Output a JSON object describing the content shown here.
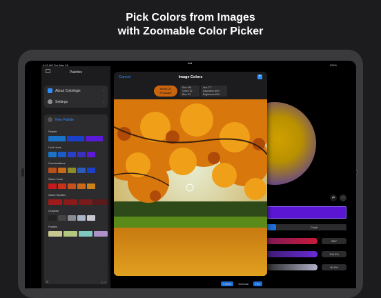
{
  "headline": {
    "line1": "Pick Colors from Images",
    "line2": "with Zoomable Color Picker"
  },
  "status": {
    "time": "9:41 AM  Tue May 18",
    "battery": "100%"
  },
  "sidebar": {
    "title": "Palettes",
    "items": [
      {
        "label": "About Colorlogix"
      },
      {
        "label": "Settings"
      }
    ],
    "new_palette": "New Palette",
    "palettes": [
      {
        "label": "Palette",
        "colors": [
          "#1a73c8",
          "#1a3fc8",
          "#5a1ad8"
        ],
        "wide": true
      },
      {
        "label": "Cool Hues",
        "colors": [
          "#1a73c8",
          "#1a5bc8",
          "#2a3fc8",
          "#3b2fc0",
          "#5a1ad8"
        ]
      },
      {
        "label": "Combinations",
        "colors": [
          "#b8501a",
          "#c86a1a",
          "#8c8c2a",
          "#2a5bb8",
          "#1a3fc8"
        ]
      },
      {
        "label": "Warm Hues",
        "colors": [
          "#c81a1a",
          "#c8301a",
          "#c8501a",
          "#c86a1a",
          "#c8841a"
        ]
      },
      {
        "label": "Warm Shades",
        "colors": [
          "#a01a1a",
          "#8c1a1a",
          "#7a1a1a",
          "#5a1a1a"
        ],
        "wide": true
      },
      {
        "label": "Graphite",
        "colors": [
          "#222222",
          "#444444",
          "#8a8a94",
          "#a8b4c8",
          "#c8c8d0"
        ]
      },
      {
        "label": "Pastels",
        "colors": [
          "#c8c890",
          "#b4c880",
          "#80c8c0",
          "#b090c8"
        ],
        "wide": true
      }
    ],
    "footer_count": "5:25"
  },
  "modal": {
    "cancel": "Cancel",
    "title": "Image Colors",
    "hex": "#AA5C21",
    "color_name": "Pheasant",
    "rgb": [
      "Red",
      "Green",
      "Blue"
    ],
    "rgb_vals": [
      "166",
      "92",
      "33"
    ],
    "hsb": [
      "Hue",
      "Saturation",
      "Brightness"
    ],
    "hsb_vals": [
      "27°",
      "80%",
      "65%"
    ]
  },
  "main": {
    "seg_label": "Cmyk",
    "stepper1": "280°",
    "stepper2": "100.0%",
    "stepper3": "90.6%",
    "tabs": [
      "Palette",
      "Decimal",
      "Hex"
    ]
  },
  "colors": {
    "accent": "#2f8cff",
    "picked": "#c8650e",
    "bar": "#5b16d3"
  }
}
